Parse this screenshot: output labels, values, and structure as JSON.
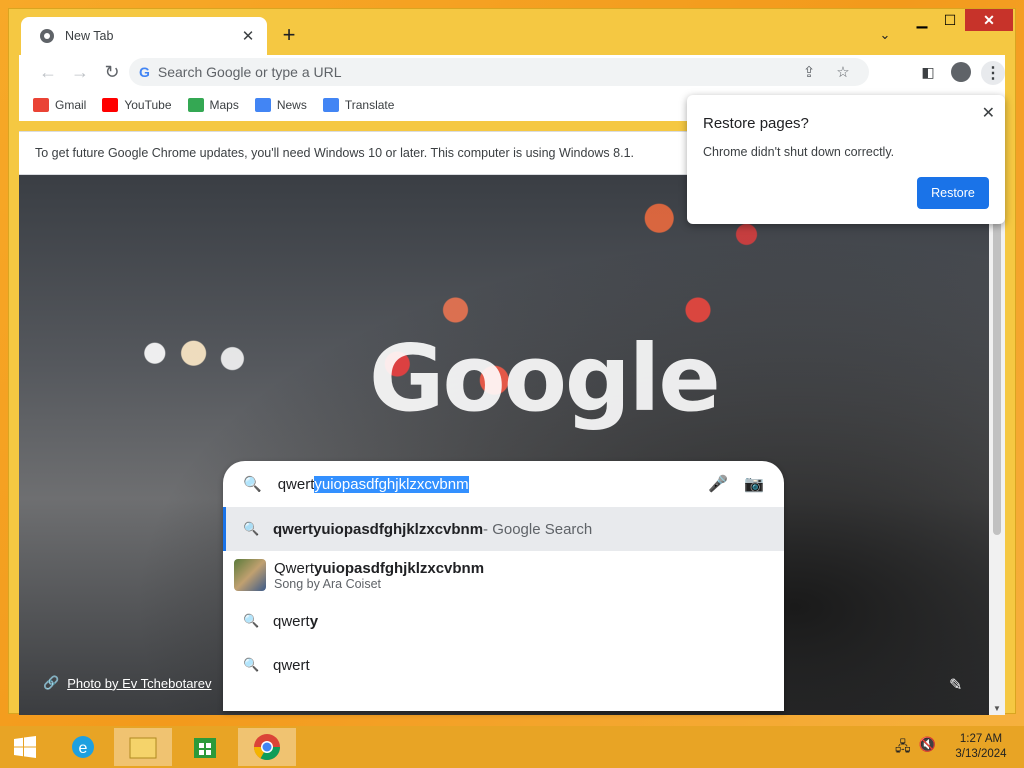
{
  "browser": {
    "tab": {
      "title": "New Tab"
    },
    "omnibox": {
      "placeholder": "Search Google or type a URL"
    }
  },
  "bookmarks": [
    {
      "label": "Gmail",
      "color": "#ea4335"
    },
    {
      "label": "YouTube",
      "color": "#ff0000"
    },
    {
      "label": "Maps",
      "color": "#34a853"
    },
    {
      "label": "News",
      "color": "#4285f4"
    },
    {
      "label": "Translate",
      "color": "#4285f4"
    }
  ],
  "infobar": {
    "message": "To get future Google Chrome updates, you'll need Windows 10 or later. This computer is using Windows 8.1."
  },
  "page": {
    "logo": "Google",
    "photo_credit": "Photo by Ev Tchebotarev"
  },
  "search": {
    "typed": "qwert",
    "selected": "yuiopasdfghjklzxcvbnm",
    "suggestions": [
      {
        "bold": "qwertyuiopasdfghjklzxcvbnm",
        "suffix": " - Google Search"
      },
      {
        "prefix": "Qwert",
        "bold": "yuiopasdfghjklzxcvbnm",
        "subtitle": "Song by Ara Coiset"
      },
      {
        "prefix": "qwert",
        "bold": "y"
      },
      {
        "prefix": "qwert",
        "bold": ""
      }
    ]
  },
  "popup": {
    "title": "Restore pages?",
    "body": "Chrome didn't shut down correctly.",
    "button": "Restore"
  },
  "taskbar": {
    "time": "1:27 AM",
    "date": "3/13/2024"
  }
}
